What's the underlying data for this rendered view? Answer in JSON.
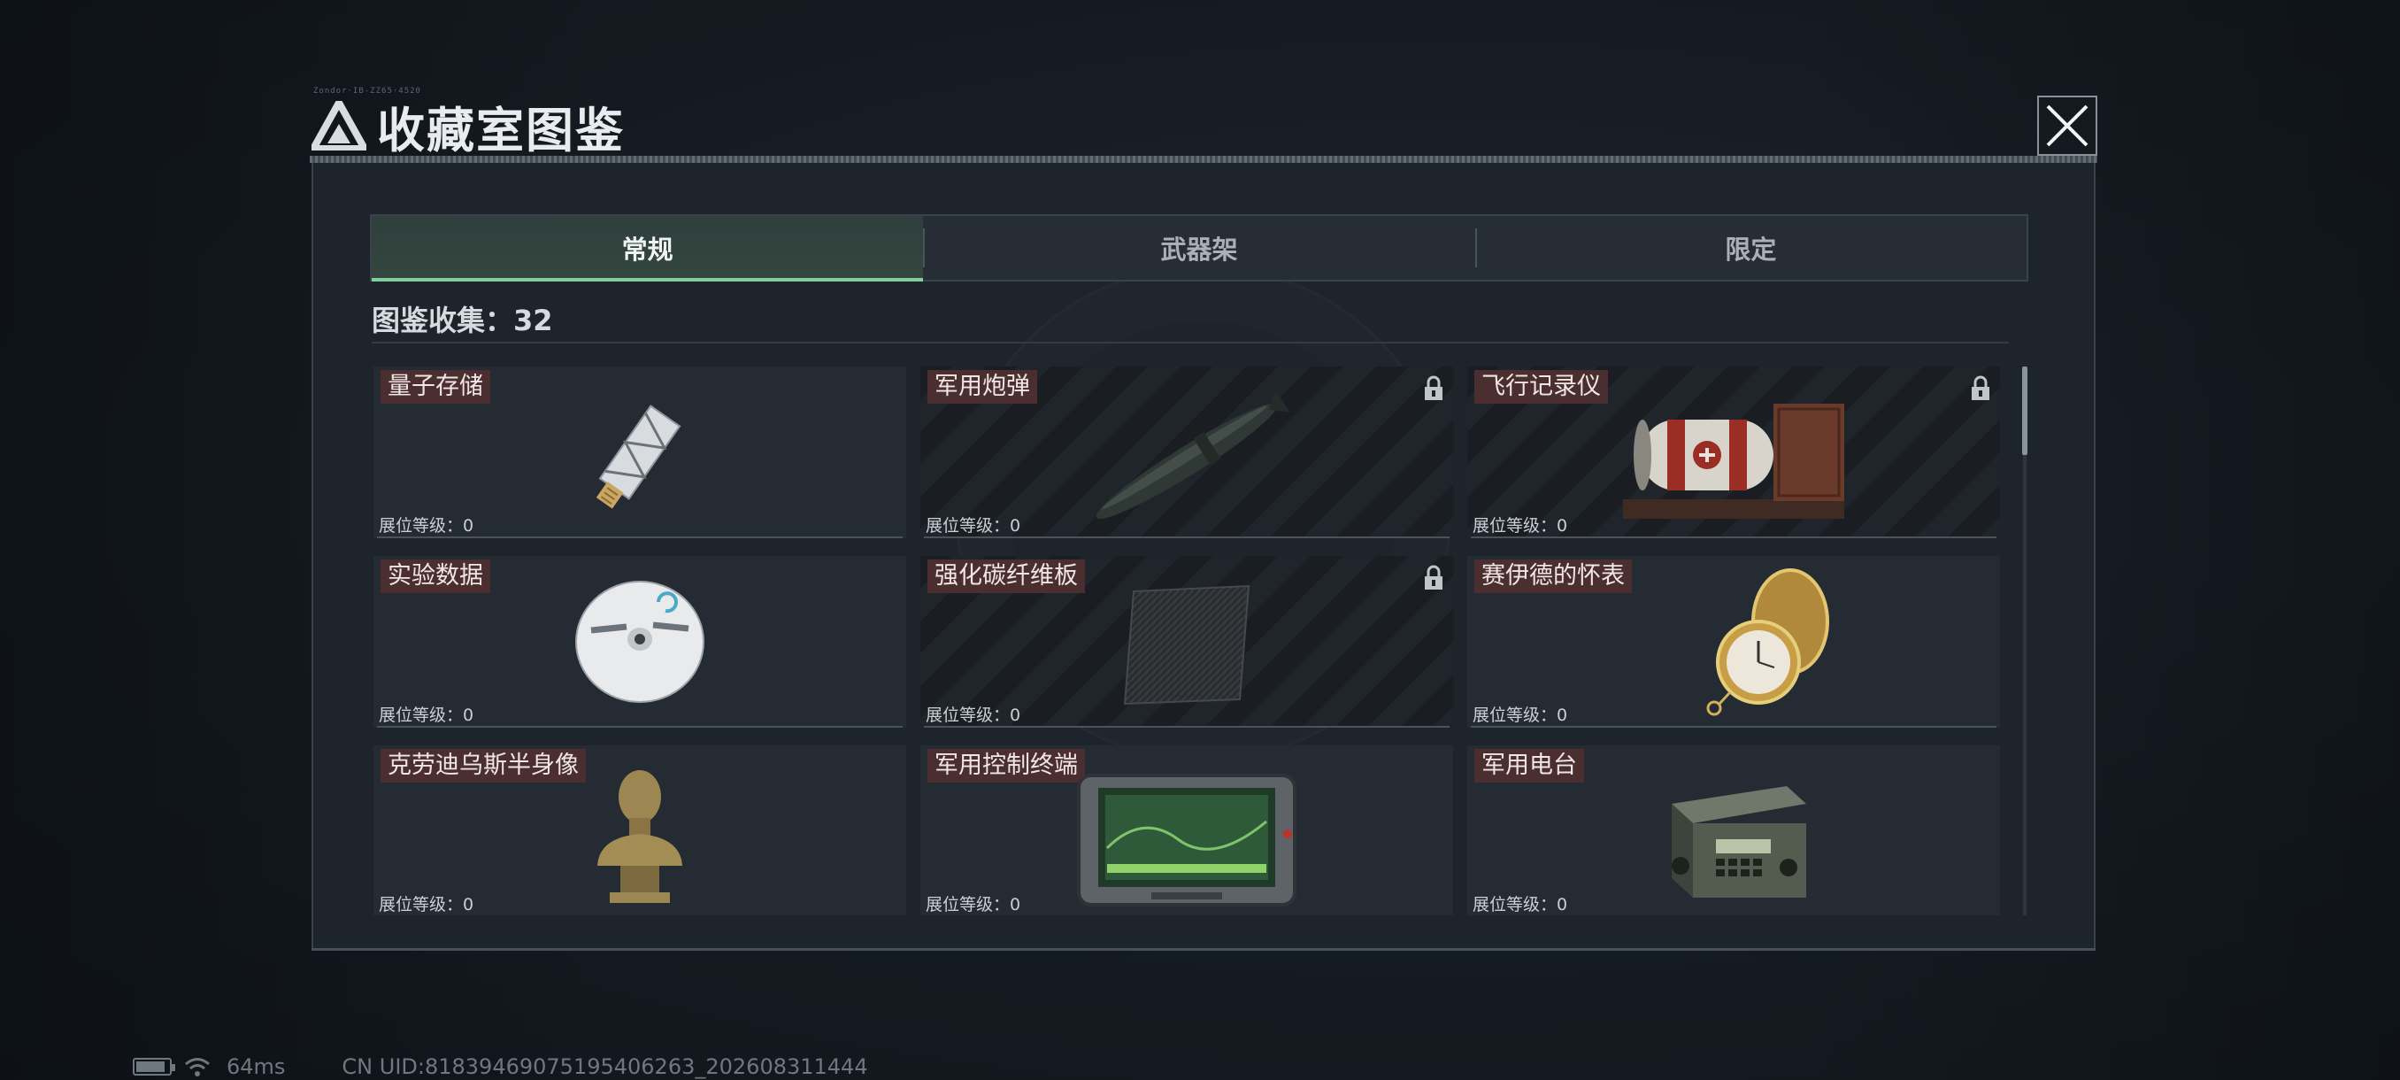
{
  "header": {
    "title": "收藏室图鉴",
    "tiny_text": "Zondor·IB-ZZ65·4520"
  },
  "tabs": [
    {
      "label": "常规",
      "active": true
    },
    {
      "label": "武器架",
      "active": false
    },
    {
      "label": "限定",
      "active": false
    }
  ],
  "collection": {
    "label": "图鉴收集：32"
  },
  "items": [
    {
      "name": "量子存储",
      "level": "展位等级：0",
      "locked": false,
      "icon": "usb-drive-icon"
    },
    {
      "name": "军用炮弹",
      "level": "展位等级：0",
      "locked": true,
      "icon": "artillery-shell-icon"
    },
    {
      "name": "飞行记录仪",
      "level": "展位等级：0",
      "locked": true,
      "icon": "flight-recorder-icon"
    },
    {
      "name": "实验数据",
      "level": "展位等级：0",
      "locked": false,
      "icon": "cd-disc-icon"
    },
    {
      "name": "强化碳纤维板",
      "level": "展位等级：0",
      "locked": true,
      "icon": "carbon-plate-icon"
    },
    {
      "name": "赛伊德的怀表",
      "level": "展位等级：0",
      "locked": false,
      "icon": "pocket-watch-icon"
    },
    {
      "name": "克劳迪乌斯半身像",
      "level": "展位等级：0",
      "locked": false,
      "icon": "bust-statue-icon"
    },
    {
      "name": "军用控制终端",
      "level": "展位等级：0",
      "locked": false,
      "icon": "control-terminal-icon"
    },
    {
      "name": "军用电台",
      "level": "展位等级：0",
      "locked": false,
      "icon": "military-radio-icon"
    }
  ],
  "status_bar": {
    "ping": "64ms",
    "uid": "CN UID:8183946907519540626​3_202608311444"
  },
  "colors": {
    "accent_green": "#7fd09a",
    "name_tag": "#4b2f30",
    "panel_bg": "#1e242b"
  }
}
